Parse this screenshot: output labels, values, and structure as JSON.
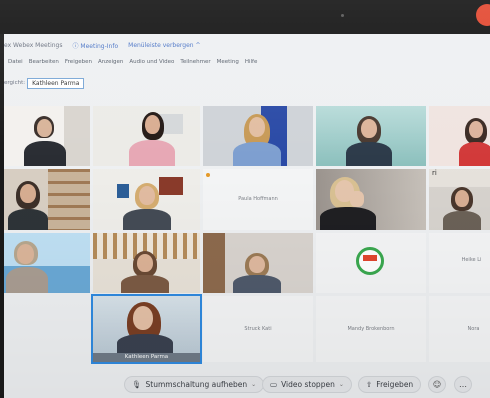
{
  "window": {
    "app_title": "ex Webex Meetings",
    "meeting_info": "Meeting-Info",
    "hide_menu": "Menüleiste verbergen ^"
  },
  "menu": [
    "Datei",
    "Bearbeiten",
    "Freigeben",
    "Anzeigen",
    "Audio und Video",
    "Teilnehmer",
    "Meeting",
    "Hilfe"
  ],
  "active_speaker": {
    "prefix": "ergicht:",
    "name": "Kathleen Parma"
  },
  "tiles": {
    "row3_col3_name": "Paula Hoffmann",
    "row4_col5_name": "Heike Li",
    "row5_col1_name": "Kathleen Parma",
    "row5_col2_name": "Struck Kati",
    "row5_col3_name": "Mandy Brokenborn",
    "row5_col4_name": "Nora"
  },
  "toolbar": {
    "mute": "Stummschaltung aufheben",
    "video": "Video stoppen",
    "share": "Freigeben"
  },
  "colors": {
    "accent": "#2f8ae0",
    "end_call": "#e2462e",
    "cdu_logo": "#3aa84f"
  }
}
